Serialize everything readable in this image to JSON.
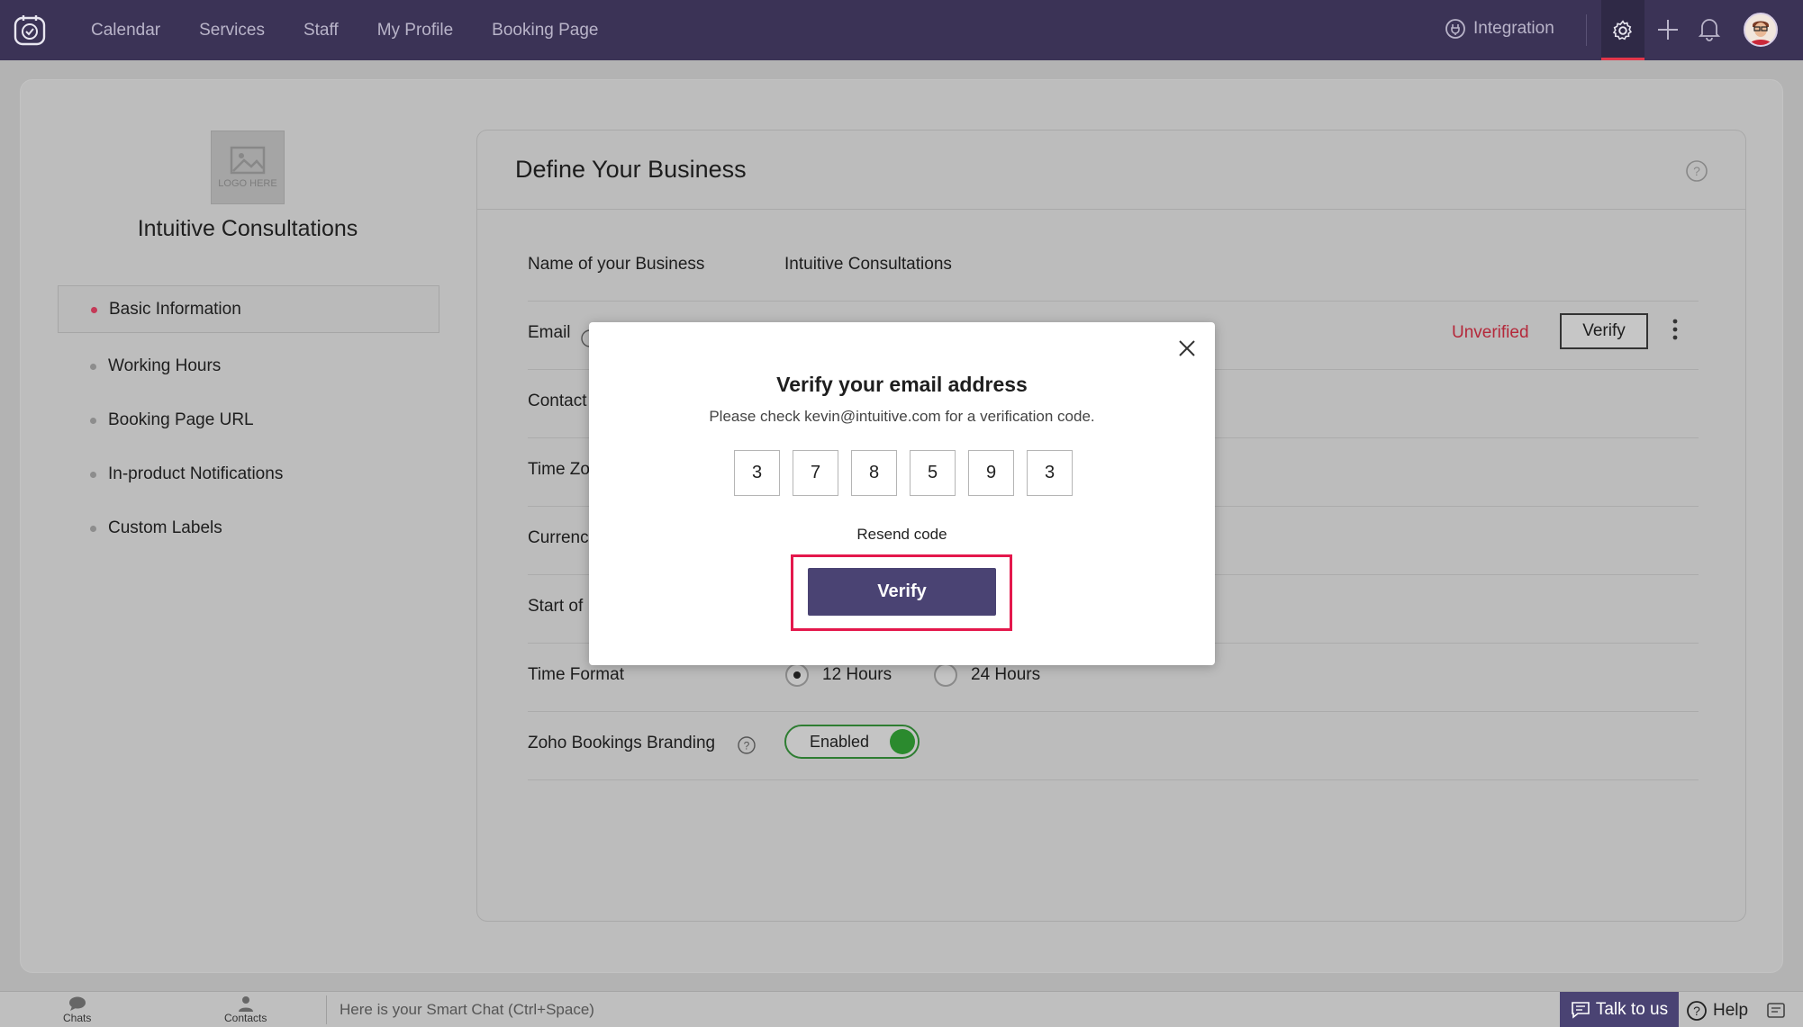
{
  "nav": {
    "links": [
      "Calendar",
      "Services",
      "Staff",
      "My Profile",
      "Booking Page"
    ],
    "integration": "Integration"
  },
  "sidebar": {
    "logo_text": "LOGO HERE",
    "business_name": "Intuitive Consultations",
    "items": [
      {
        "label": "Basic Information",
        "active": true
      },
      {
        "label": "Working Hours"
      },
      {
        "label": "Booking Page URL"
      },
      {
        "label": "In-product Notifications"
      },
      {
        "label": "Custom Labels"
      }
    ]
  },
  "panel": {
    "title": "Define Your Business",
    "rows": {
      "business_name_label": "Name of your Business",
      "business_name_value": "Intuitive Consultations",
      "email_label": "Email",
      "email_status": "Unverified",
      "email_verify": "Verify",
      "contact_label": "Contact",
      "timezone_label": "Time Zo",
      "currency_label": "Currenc",
      "start_label": "Start of",
      "time_format_label": "Time Format",
      "time_format_12": "12 Hours",
      "time_format_24": "24 Hours",
      "time_format_selected": "12 Hours",
      "branding_label": "Zoho Bookings Branding",
      "branding_value": "Enabled"
    }
  },
  "modal": {
    "title": "Verify your email address",
    "subtitle": "Please check kevin@intuitive.com for a verification code.",
    "code": [
      "3",
      "7",
      "8",
      "5",
      "9",
      "3"
    ],
    "resend": "Resend code",
    "verify": "Verify"
  },
  "bottom": {
    "chats": "Chats",
    "contacts": "Contacts",
    "smartchat": "Here is your Smart Chat (Ctrl+Space)",
    "talk": "Talk to us",
    "help": "Help"
  },
  "colors": {
    "nav_bg": "#3b3356",
    "accent": "#4a4373",
    "highlight": "#e4184c",
    "unverified": "#b4283a",
    "toggle_on": "#2b8a2e"
  }
}
